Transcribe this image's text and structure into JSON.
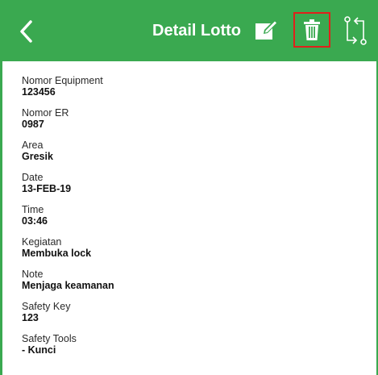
{
  "header": {
    "title": "Detail Lotto",
    "bg_color": "#3aa950",
    "highlight_color": "#e0201b",
    "icons": {
      "back": "chevron-left-icon",
      "edit": "edit-icon",
      "delete": "trash-icon",
      "swap": "swap-arrows-icon"
    }
  },
  "fields": [
    {
      "label": "Nomor Equipment",
      "value": "123456"
    },
    {
      "label": "Nomor ER",
      "value": "0987"
    },
    {
      "label": "Area",
      "value": "Gresik"
    },
    {
      "label": "Date",
      "value": "13-FEB-19"
    },
    {
      "label": "Time",
      "value": "03:46"
    },
    {
      "label": "Kegiatan",
      "value": "Membuka lock"
    },
    {
      "label": "Note",
      "value": "Menjaga keamanan"
    },
    {
      "label": "Safety Key",
      "value": "123"
    },
    {
      "label": "Safety Tools",
      "value": "- Kunci"
    }
  ]
}
